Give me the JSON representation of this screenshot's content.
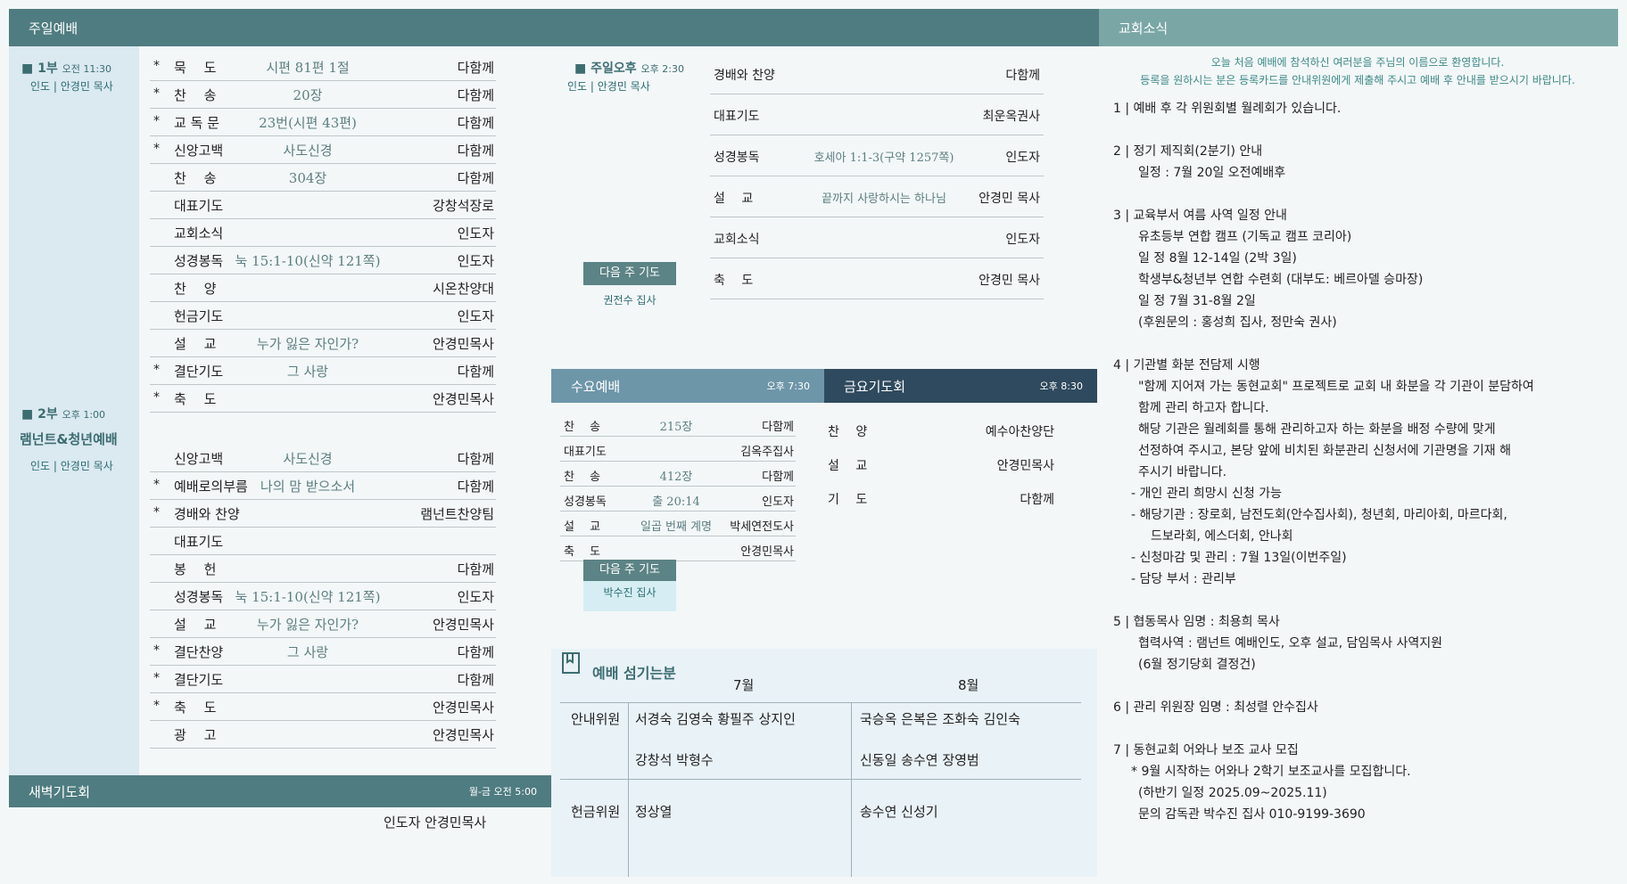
{
  "sunday": {
    "header": "주일예배",
    "first": {
      "title": "1부",
      "time": "오전 11:30",
      "leader": "인도 | 안경민 목사"
    },
    "second": {
      "title": "2부",
      "time": "오후 1:00",
      "subtitle": "램넌트&청년예배",
      "leader": "인도 | 안경민 목사"
    },
    "rows1": [
      {
        "star": "*",
        "label": "묵　 도",
        "middle": "시편 81편 1절",
        "right": "다함께"
      },
      {
        "star": "*",
        "label": "찬　 송",
        "middle": "20장",
        "right": "다함께"
      },
      {
        "star": "*",
        "label": "교 독 문",
        "middle": "23번(시편 43편)",
        "right": "다함께"
      },
      {
        "star": "*",
        "label": "신앙고백",
        "middle": "사도신경",
        "right": "다함께"
      },
      {
        "star": "",
        "label": "찬　 송",
        "middle": "304장",
        "right": "다함께"
      },
      {
        "star": "",
        "label": "대표기도",
        "middle": "",
        "right": "강창석장로"
      },
      {
        "star": "",
        "label": "교회소식",
        "middle": "",
        "right": "인도자"
      },
      {
        "star": "",
        "label": "성경봉독",
        "middle": "눅 15:1-10(신약 121쪽)",
        "right": "인도자"
      },
      {
        "star": "",
        "label": "찬　 양",
        "middle": "",
        "right": "시온찬양대"
      },
      {
        "star": "",
        "label": "헌금기도",
        "middle": "",
        "right": "인도자"
      },
      {
        "star": "",
        "label": "설　 교",
        "middle": "누가 잃은 자인가?",
        "right": "안경민목사"
      },
      {
        "star": "*",
        "label": "결단기도",
        "middle": "그 사랑",
        "right": "다함께"
      },
      {
        "star": "*",
        "label": "축　 도",
        "middle": "",
        "right": "안경민목사"
      }
    ],
    "rows2": [
      {
        "star": "",
        "label": "신앙고백",
        "middle": "사도신경",
        "right": "다함께"
      },
      {
        "star": "*",
        "label": "예배로의부름",
        "middle": "나의 맘 받으소서",
        "right": "다함께"
      },
      {
        "star": "*",
        "label": "경배와 찬양",
        "middle": "",
        "right": "램넌트찬양팀"
      },
      {
        "star": "",
        "label": "대표기도",
        "middle": "",
        "right": ""
      },
      {
        "star": "",
        "label": "봉　 헌",
        "middle": "",
        "right": "다함께"
      },
      {
        "star": "",
        "label": "성경봉독",
        "middle": "눅 15:1-10(신약 121쪽)",
        "right": "인도자"
      },
      {
        "star": "",
        "label": "설　 교",
        "middle": "누가 잃은 자인가?",
        "right": "안경민목사"
      },
      {
        "star": "*",
        "label": "결단찬양",
        "middle": "그 사랑",
        "right": "다함께"
      },
      {
        "star": "*",
        "label": "결단기도",
        "middle": "",
        "right": "다함께"
      },
      {
        "star": "*",
        "label": "축　 도",
        "middle": "",
        "right": "안경민목사"
      },
      {
        "star": "",
        "label": "광　 고",
        "middle": "",
        "right": "안경민목사"
      }
    ]
  },
  "dawn": {
    "header": "새벽기도회",
    "time": "월-금 오전 5:00",
    "leader": "인도자 안경민목사"
  },
  "afternoon": {
    "title": "주일오후",
    "time": "오후 2:30",
    "leader": "인도 | 안경민 목사",
    "rows": [
      {
        "label": "경배와 찬양",
        "middle": "",
        "right": "다함께"
      },
      {
        "label": "대표기도",
        "middle": "",
        "right": "최운옥권사"
      },
      {
        "label": "성경봉독",
        "middle": "호세아 1:1-3(구약 1257쪽)",
        "right": "인도자"
      },
      {
        "label": "설　 교",
        "middle": "끝까지 사랑하시는 하나님",
        "right": "안경민 목사"
      },
      {
        "label": "교회소식",
        "middle": "",
        "right": "인도자"
      },
      {
        "label": "축　 도",
        "middle": "",
        "right": "안경민 목사"
      }
    ],
    "next_label": "다음 주 기도",
    "next_name": "권전수 집사"
  },
  "wednesday": {
    "header": "수요예배",
    "time": "오후 7:30",
    "rows": [
      {
        "label": "찬　 송",
        "middle": "215장",
        "right": "다함께"
      },
      {
        "label": "대표기도",
        "middle": "",
        "right": "김옥주집사"
      },
      {
        "label": "찬　 송",
        "middle": "412장",
        "right": "다함께"
      },
      {
        "label": "성경봉독",
        "middle": "출 20:14",
        "right": "인도자"
      },
      {
        "label": "설　 교",
        "middle": "일곱 번째 계명",
        "right": "박세연전도사"
      },
      {
        "label": "축　 도",
        "middle": "",
        "right": "안경민목사"
      }
    ],
    "next_label": "다음 주 기도",
    "next_name": "박수진 집사"
  },
  "friday": {
    "header": "금요기도회",
    "time": "오후 8:30",
    "rows": [
      {
        "label": "찬　 양",
        "right": "예수아찬양단"
      },
      {
        "label": "설　 교",
        "right": "안경민목사"
      },
      {
        "label": "기　 도",
        "right": "다함께"
      }
    ]
  },
  "duty": {
    "title": "예배 섬기는분",
    "month1": "7월",
    "month2": "8월",
    "guide_label": "안내위원",
    "guide_jul_1": "서경숙 김영숙 황필주 상지인",
    "guide_jul_2": "강창석 박형수",
    "guide_aug_1": "국승옥 은복은 조화숙 김인숙",
    "guide_aug_2": "신동일 송수연 장영범",
    "offer_label": "헌금위원",
    "offer_jul": "정상열",
    "offer_aug": "송수연 신성기"
  },
  "news": {
    "header": "교회소식",
    "welcome1": "오늘 처음 예배에 참석하신 여러분을 주님의 이름으로 환영합니다.",
    "welcome2": "등록을 원하시는 분은 등록카드를 안내위원에게 제출해 주시고 예배 후 안내를 받으시기 바랍니다.",
    "items": [
      [
        "1 | 예배 후 각 위원회별 월례회가 있습니다."
      ],
      [
        "2 | 정기 제직회(2분기) 안내",
        "일정 : 7월 20일 오전예배후"
      ],
      [
        "3 | 교육부서 여름 사역 일정 안내",
        "유초등부 연합 캠프 (기독교 캠프 코리아)",
        "일 정 8월 12-14일 (2박 3일)",
        "학생부&청년부 연합 수련회 (대부도: 베르아델 승마장)",
        "일 정 7월 31-8월 2일",
        "(후원문의 : 홍성희 집사, 정만숙 권사)"
      ],
      [
        "4 | 기관별 화분 전담제 시행",
        "\"함께 지어져 가는 동현교회\" 프로젝트로 교회 내 화분을  각 기관이 분담하여",
        "함께 관리 하고자 합니다.",
        "해당 기관은 월례회를 통해 관리하고자 하는 화분을 배정 수량에 맞게",
        "선정하여 주시고, 본당 앞에 비치된 화분관리 신청서에 기관명을 기재 해",
        "주시기 바랍니다.",
        "- 개인 관리 희망시 신청 가능",
        "- 해당기관 : 장로회, 남전도회(안수집사회), 청년회, 마리아회, 마르다회,",
        "드보라회, 에스더회, 안나회",
        "- 신청마감 및 관리 :  7월 13일(이번주일)",
        "- 담당 부서 : 관리부"
      ],
      [
        "5 | 협동목사 임명 : 최용희 목사",
        "협력사역 : 램넌트 예배인도, 오후 설교, 담임목사 사역지원",
        "(6월 정기당회 결정건)"
      ],
      [
        "6 | 관리 위원장 임명 : 최성렬 안수집사"
      ],
      [
        "7 | 동현교회 어와나 보조 교사 모집",
        "* 9월 시작하는 어와나 2학기 보조교사를 모집합니다.",
        "(하반기 일정 2025.09~2025.11)",
        "문의 감독관 박수진 집사 010-9199-3690"
      ]
    ]
  }
}
